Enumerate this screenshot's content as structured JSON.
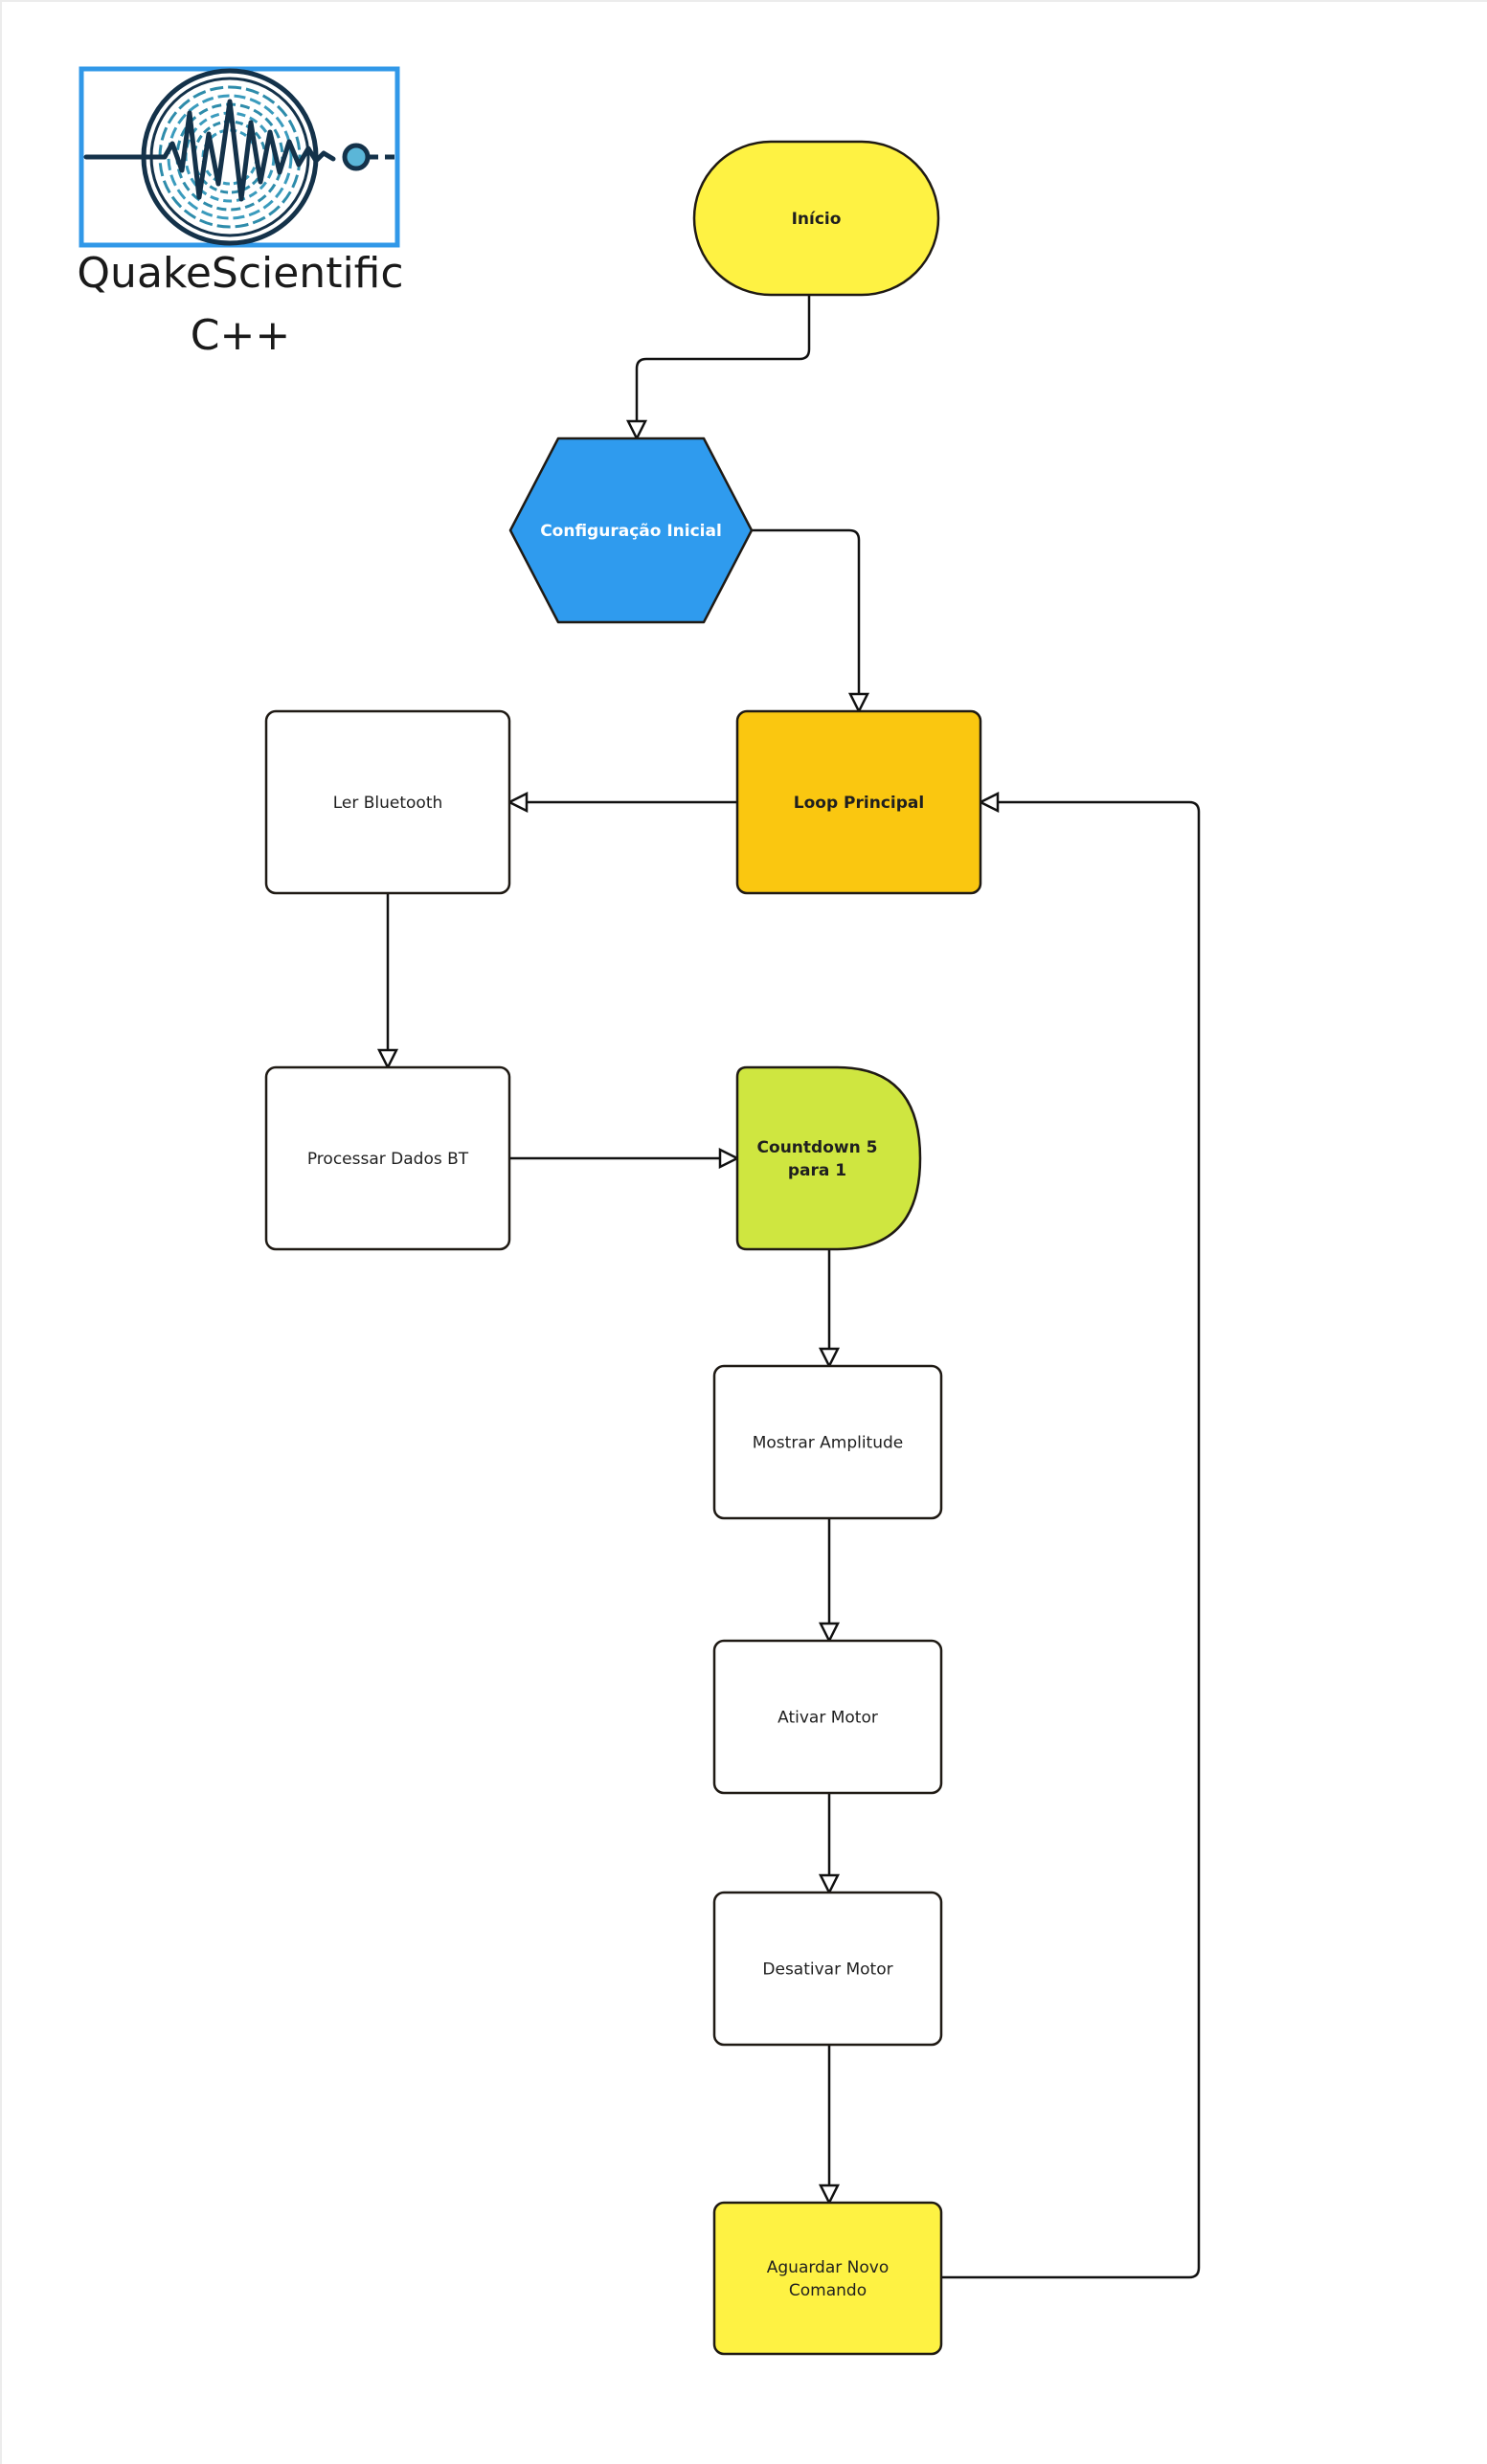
{
  "logo": {
    "title_line1": "QuakeScientific",
    "title_line2": "C++",
    "frame_color": "#3198e8",
    "wave_color": "#14324a",
    "ring_color": "#2e8cab"
  },
  "nodes": [
    {
      "id": "inicio",
      "label": [
        "Início"
      ],
      "shape": "terminal",
      "fill": "#fef243",
      "bold": true
    },
    {
      "id": "configuracao-inicial",
      "label": [
        "Configuração Inicial"
      ],
      "shape": "hexagon",
      "fill": "#2f9bee",
      "bold": true,
      "text_color": "#ffffff"
    },
    {
      "id": "loop-principal",
      "label": [
        "Loop Principal"
      ],
      "shape": "rect",
      "fill": "#fac710",
      "bold": true
    },
    {
      "id": "ler-bluetooth",
      "label": [
        "Ler Bluetooth"
      ],
      "shape": "rect",
      "fill": "#ffffff",
      "bold": false
    },
    {
      "id": "processar-dados-bt",
      "label": [
        "Processar Dados BT"
      ],
      "shape": "rect",
      "fill": "#ffffff",
      "bold": false
    },
    {
      "id": "countdown",
      "label": [
        "Countdown 5",
        "para 1"
      ],
      "shape": "delay",
      "fill": "#cfe640",
      "bold": true
    },
    {
      "id": "mostrar-amplitude",
      "label": [
        "Mostrar Amplitude"
      ],
      "shape": "rect",
      "fill": "#ffffff",
      "bold": false
    },
    {
      "id": "ativar-motor",
      "label": [
        "Ativar Motor"
      ],
      "shape": "rect",
      "fill": "#ffffff",
      "bold": false
    },
    {
      "id": "desativar-motor",
      "label": [
        "Desativar Motor"
      ],
      "shape": "rect",
      "fill": "#ffffff",
      "bold": false
    },
    {
      "id": "aguardar-novo-comando",
      "label": [
        "Aguardar Novo",
        "Comando"
      ],
      "shape": "rect",
      "fill": "#fef243",
      "bold": false
    }
  ],
  "edges": [
    {
      "from": "inicio",
      "to": "configuracao-inicial"
    },
    {
      "from": "configuracao-inicial",
      "to": "loop-principal"
    },
    {
      "from": "loop-principal",
      "to": "ler-bluetooth"
    },
    {
      "from": "ler-bluetooth",
      "to": "processar-dados-bt"
    },
    {
      "from": "processar-dados-bt",
      "to": "countdown"
    },
    {
      "from": "countdown",
      "to": "mostrar-amplitude"
    },
    {
      "from": "mostrar-amplitude",
      "to": "ativar-motor"
    },
    {
      "from": "ativar-motor",
      "to": "desativar-motor"
    },
    {
      "from": "desativar-motor",
      "to": "aguardar-novo-comando"
    },
    {
      "from": "aguardar-novo-comando",
      "to": "loop-principal"
    }
  ]
}
